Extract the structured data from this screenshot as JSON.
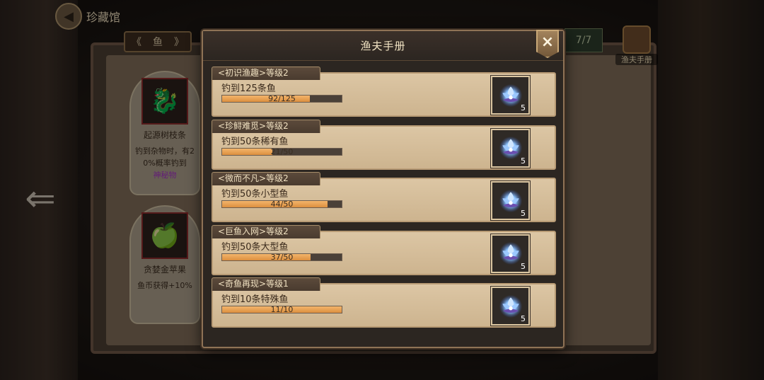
{
  "background": {
    "title": "珍藏馆",
    "tab_label": "鱼",
    "tab_arrows": [
      "《",
      "》"
    ],
    "counter": "7/7",
    "manual_label": "渔夫手册",
    "cards": [
      {
        "name": "起源树枝条",
        "desc_a": "钓到杂物时，有2",
        "desc_b": "0%概率钓到",
        "desc_purple": "神秘物"
      },
      {
        "name": "贪婪金苹果",
        "desc_a": "鱼币获得+10%",
        "desc_b": "",
        "desc_purple": ""
      }
    ]
  },
  "modal": {
    "title": "渔夫手册",
    "close_glyph": "×",
    "quests": [
      {
        "tab": "<初识渔趣>等级2",
        "desc": "钓到125条鱼",
        "progress_text": "92/125",
        "progress": 0.736,
        "reward_count": "5",
        "reward_icon": "glowing-lotus-icon"
      },
      {
        "tab": "<珍鲟难觅>等级2",
        "desc": "钓到50条稀有鱼",
        "progress_text": "21/50",
        "progress": 0.42,
        "reward_count": "5",
        "reward_icon": "glowing-lotus-icon"
      },
      {
        "tab": "<微而不凡>等级2",
        "desc": "钓到50条小型鱼",
        "progress_text": "44/50",
        "progress": 0.88,
        "reward_count": "5",
        "reward_icon": "glowing-lotus-icon"
      },
      {
        "tab": "<巨鱼入网>等级2",
        "desc": "钓到50条大型鱼",
        "progress_text": "37/50",
        "progress": 0.74,
        "reward_count": "5",
        "reward_icon": "glowing-lotus-icon"
      },
      {
        "tab": "<奇鱼再现>等级1",
        "desc": "钓到10条特殊鱼",
        "progress_text": "11/10",
        "progress": 1.0,
        "reward_count": "5",
        "reward_icon": "glowing-lotus-icon"
      }
    ]
  },
  "colors": {
    "progress_fill": "#e9a250",
    "reward_glow": "#5aa0ff",
    "panel": "#d6bf9b"
  }
}
